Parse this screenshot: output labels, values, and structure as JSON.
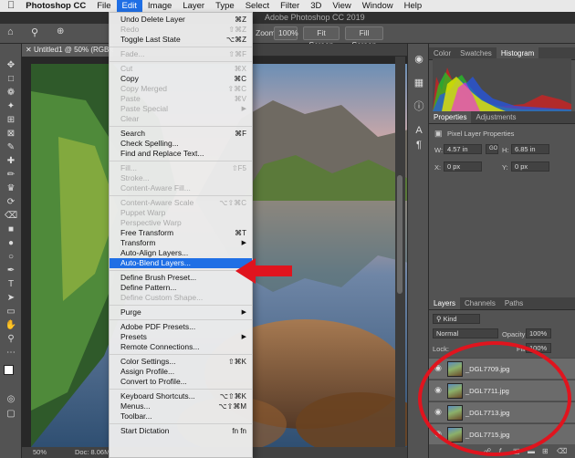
{
  "menubar": {
    "apple": "",
    "app_name": "Photoshop CC",
    "items": [
      "File",
      "Edit",
      "Image",
      "Layer",
      "Type",
      "Select",
      "Filter",
      "3D",
      "View",
      "Window",
      "Help"
    ]
  },
  "window_title": "Adobe Photoshop CC 2019",
  "options_bar": {
    "zoom_label": "Zoom",
    "zoom_100": "100%",
    "fit_screen": "Fit Screen",
    "fill_screen": "Fill Screen"
  },
  "document": {
    "tab_label": "Untitled1 @ 50% (RGB/8",
    "status_zoom": "50%",
    "status_doc": "Doc: 8.06M"
  },
  "edit_menu": {
    "items": [
      {
        "label": "Undo Delete Layer",
        "shortcut": "⌘Z",
        "enabled": true
      },
      {
        "label": "Redo",
        "shortcut": "⇧⌘Z",
        "enabled": false
      },
      {
        "label": "Toggle Last State",
        "shortcut": "⌥⌘Z",
        "enabled": true
      },
      {
        "sep": true
      },
      {
        "label": "Fade...",
        "shortcut": "⇧⌘F",
        "enabled": false
      },
      {
        "sep": true
      },
      {
        "label": "Cut",
        "shortcut": "⌘X",
        "enabled": false
      },
      {
        "label": "Copy",
        "shortcut": "⌘C",
        "enabled": true
      },
      {
        "label": "Copy Merged",
        "shortcut": "⇧⌘C",
        "enabled": false
      },
      {
        "label": "Paste",
        "shortcut": "⌘V",
        "enabled": false
      },
      {
        "label": "Paste Special",
        "submenu": true,
        "enabled": false
      },
      {
        "label": "Clear",
        "enabled": false
      },
      {
        "sep": true
      },
      {
        "label": "Search",
        "shortcut": "⌘F",
        "enabled": true
      },
      {
        "label": "Check Spelling...",
        "enabled": true
      },
      {
        "label": "Find and Replace Text...",
        "enabled": true
      },
      {
        "sep": true
      },
      {
        "label": "Fill...",
        "shortcut": "⇧F5",
        "enabled": false
      },
      {
        "label": "Stroke...",
        "enabled": false
      },
      {
        "label": "Content-Aware Fill...",
        "enabled": false
      },
      {
        "sep": true
      },
      {
        "label": "Content-Aware Scale",
        "shortcut": "⌥⇧⌘C",
        "enabled": false
      },
      {
        "label": "Puppet Warp",
        "enabled": false
      },
      {
        "label": "Perspective Warp",
        "enabled": false
      },
      {
        "label": "Free Transform",
        "shortcut": "⌘T",
        "enabled": true
      },
      {
        "label": "Transform",
        "submenu": true,
        "enabled": true
      },
      {
        "label": "Auto-Align Layers...",
        "enabled": true
      },
      {
        "label": "Auto-Blend Layers...",
        "enabled": true,
        "highlighted": true
      },
      {
        "sep": true
      },
      {
        "label": "Define Brush Preset...",
        "enabled": true
      },
      {
        "label": "Define Pattern...",
        "enabled": true
      },
      {
        "label": "Define Custom Shape...",
        "enabled": false
      },
      {
        "sep": true
      },
      {
        "label": "Purge",
        "submenu": true,
        "enabled": true
      },
      {
        "sep": true
      },
      {
        "label": "Adobe PDF Presets...",
        "enabled": true
      },
      {
        "label": "Presets",
        "submenu": true,
        "enabled": true
      },
      {
        "label": "Remote Connections...",
        "enabled": true
      },
      {
        "sep": true
      },
      {
        "label": "Color Settings...",
        "shortcut": "⇧⌘K",
        "enabled": true
      },
      {
        "label": "Assign Profile...",
        "enabled": true
      },
      {
        "label": "Convert to Profile...",
        "enabled": true
      },
      {
        "sep": true
      },
      {
        "label": "Keyboard Shortcuts...",
        "shortcut": "⌥⇧⌘K",
        "enabled": true
      },
      {
        "label": "Menus...",
        "shortcut": "⌥⇧⌘M",
        "enabled": true
      },
      {
        "label": "Toolbar...",
        "enabled": true
      },
      {
        "sep": true
      },
      {
        "label": "Start Dictation",
        "shortcut": "fn fn",
        "enabled": true
      }
    ]
  },
  "panels": {
    "top_tabs": [
      "Color",
      "Swatches",
      "Histogram"
    ],
    "properties_tabs": [
      "Properties",
      "Adjustments"
    ],
    "properties_title": "Pixel Layer Properties",
    "w_label": "W:",
    "w_value": "4.57 in",
    "h_label": "H:",
    "h_value": "6.85 in",
    "x_label": "X:",
    "x_value": "0 px",
    "y_label": "Y:",
    "y_value": "0 px",
    "link_label": "GO",
    "layers_tabs": [
      "Layers",
      "Channels",
      "Paths"
    ],
    "kind_label": "Kind",
    "blend_mode": "Normal",
    "opacity_label": "Opacity:",
    "opacity_value": "100%",
    "lock_label": "Lock:",
    "fill_label": "Fill:",
    "fill_value": "100%",
    "layers": [
      "_DGL7709.jpg",
      "_DGL7711.jpg",
      "_DGL7713.jpg",
      "_DGL7715.jpg"
    ]
  },
  "colors": {
    "menu_highlight": "#1f6fe5",
    "annotation_red": "#e0141e"
  }
}
